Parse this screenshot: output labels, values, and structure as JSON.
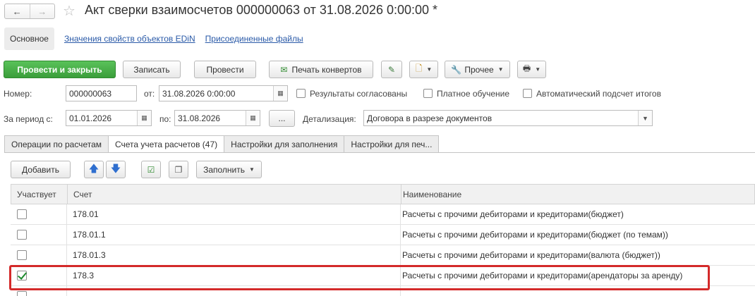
{
  "window": {
    "title": "Акт сверки взаимосчетов 000000063 от 31.08.2026 0:00:00 *",
    "back_icon": "arrow-left",
    "forward_icon": "arrow-right",
    "favorite_icon": "star"
  },
  "nav": {
    "main": "Основное",
    "links": [
      "Значения свойств объектов EDiN",
      "Присоединенные файлы"
    ]
  },
  "toolbar": {
    "post_close": "Провести и закрыть",
    "save": "Записать",
    "post": "Провести",
    "print_envelopes": "Печать конвертов",
    "other": "Прочее"
  },
  "form": {
    "number_label": "Номер:",
    "number_value": "000000063",
    "from_label": "от:",
    "from_value": "31.08.2026  0:00:00",
    "agreed_label": "Результаты согласованы",
    "paid_label": "Платное обучение",
    "auto_label": "Автоматический подсчет итогов",
    "period_label": "За период с:",
    "period_from": "01.01.2026",
    "period_to_label": "по:",
    "period_to": "31.08.2026",
    "ellipsis": "...",
    "detail_label": "Детализация:",
    "detail_value": "Договора в разрезе документов"
  },
  "tabs": [
    "Операции по расчетам",
    "Счета учета расчетов (47)",
    "Настройки для заполнения",
    "Настройки для печ..."
  ],
  "table_toolbar": {
    "add": "Добавить",
    "fill": "Заполнить"
  },
  "table": {
    "headers": [
      "Участвует",
      "Счет",
      "Наименование"
    ],
    "rows": [
      {
        "checked": false,
        "account": "178.01",
        "name": "Расчеты с прочими дебиторами и кредиторами(бюджет)"
      },
      {
        "checked": false,
        "account": "178.01.1",
        "name": "Расчеты с прочими дебиторами и кредиторами(бюджет (по темам))"
      },
      {
        "checked": false,
        "account": "178.01.3",
        "name": "Расчеты с прочими дебиторами и кредиторами(валюта (бюджет))"
      },
      {
        "checked": true,
        "account": "178.3",
        "name": "Расчеты с прочими дебиторами и кредиторами(арендаторы за  аренду)"
      }
    ]
  },
  "colors": {
    "primary": "#3a9e3a",
    "link": "#2a5aa8",
    "highlight": "#d42a2a"
  }
}
